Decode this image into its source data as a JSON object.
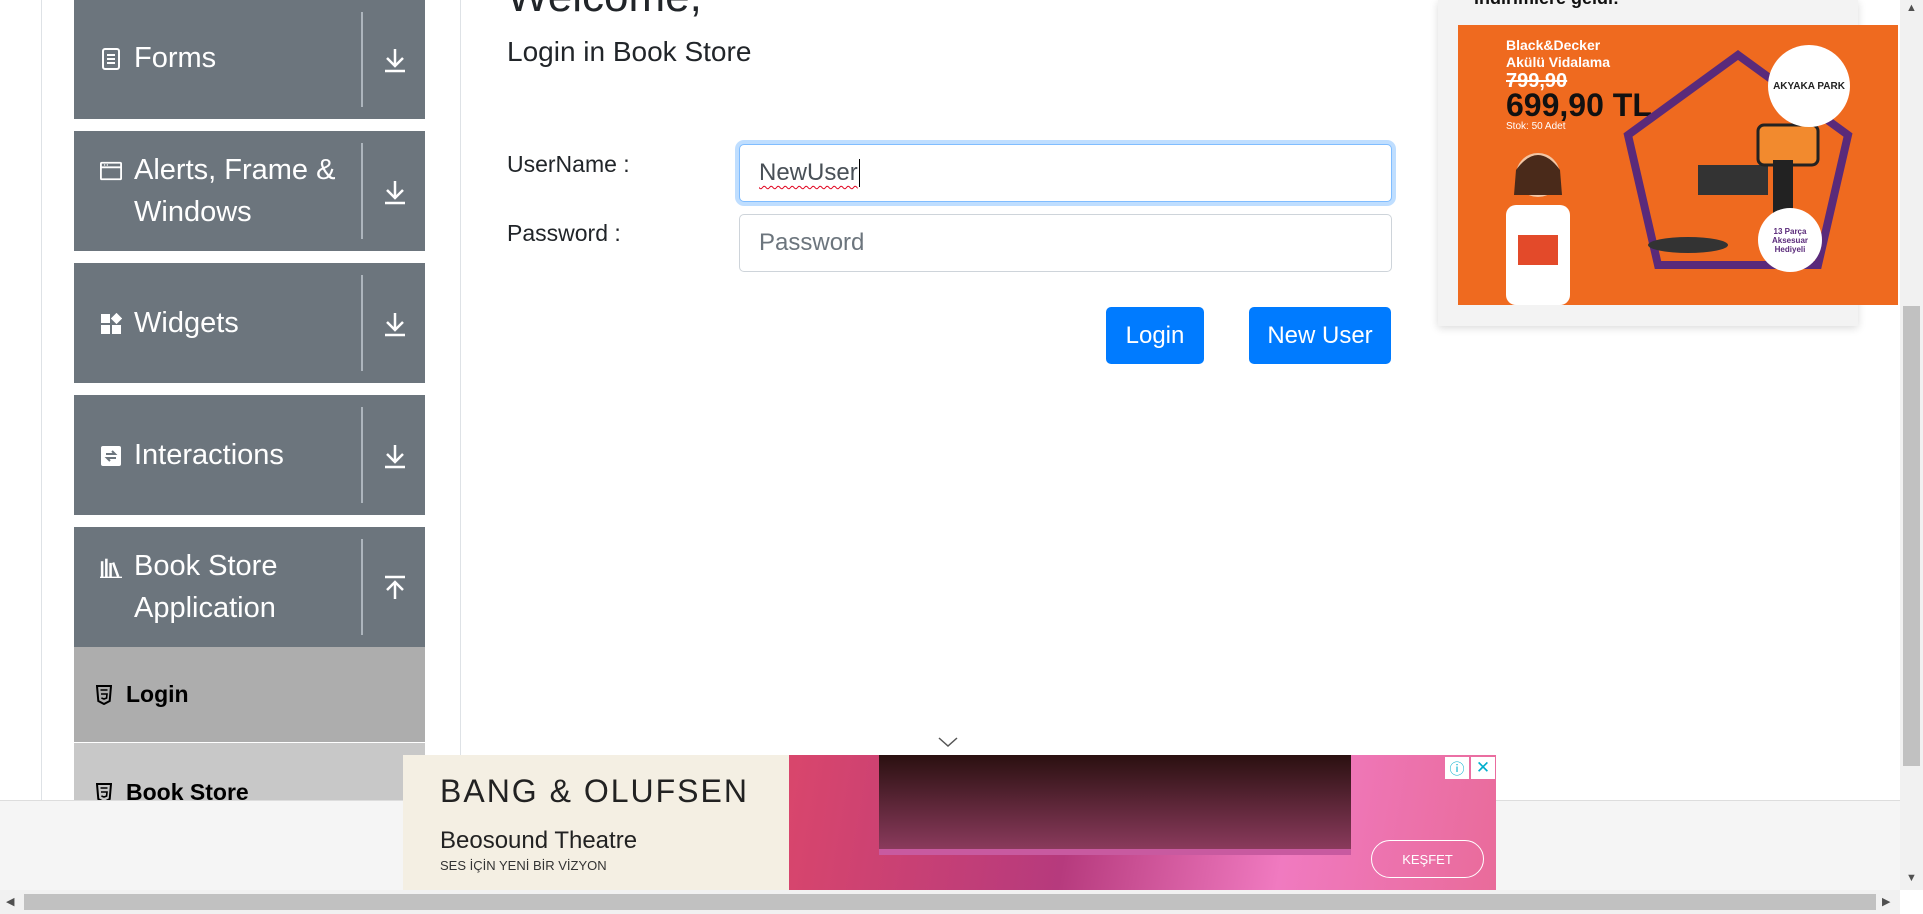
{
  "sidebar": {
    "groups": [
      {
        "label_lines": [
          "Forms"
        ],
        "icon": "form-icon",
        "arrow": "download-arrow-icon"
      },
      {
        "label_lines": [
          "Alerts, Frame &",
          "Windows"
        ],
        "icon": "window-icon",
        "arrow": "download-arrow-icon"
      },
      {
        "label_lines": [
          "Widgets"
        ],
        "icon": "widgets-icon",
        "arrow": "download-arrow-icon"
      },
      {
        "label_lines": [
          "Interactions"
        ],
        "icon": "interactions-icon",
        "arrow": "download-arrow-icon"
      },
      {
        "label_lines": [
          "Book Store",
          "Application"
        ],
        "icon": "books-icon",
        "arrow": "upload-arrow-icon"
      }
    ],
    "sub_items": [
      {
        "label": "Login",
        "icon": "html5-icon",
        "active": true
      },
      {
        "label": "Book Store",
        "icon": "html5-icon",
        "active": false
      }
    ]
  },
  "main": {
    "welcome": "Welcome,",
    "subtitle": "Login in Book Store",
    "username_label": "UserName :",
    "username_value": "NewUser",
    "password_label": "Password :",
    "password_placeholder": "Password",
    "login_button": "Login",
    "new_user_button": "New User"
  },
  "right_ad": {
    "headline": "indirimlere geldi!",
    "brand_line1": "Black&Decker",
    "brand_line2": "Akülü Vidalama",
    "old_price": "799,90",
    "price": "699,90 TL",
    "stock": "Stok: 50 Adet",
    "store": "AKYAKA PARK",
    "gift": "13 Parça Aksesuar Hediyeli"
  },
  "bottom_ad": {
    "brand": "BANG & OLUFSEN",
    "product": "Beosound Theatre",
    "tagline": "SES İÇİN YENİ BİR VİZYON",
    "cta": "KEŞFET"
  },
  "colors": {
    "sidebar_bg": "#6c757d",
    "sub_item_bg": "#adadad",
    "primary": "#007bff",
    "ad_orange": "#ef6a1f"
  }
}
